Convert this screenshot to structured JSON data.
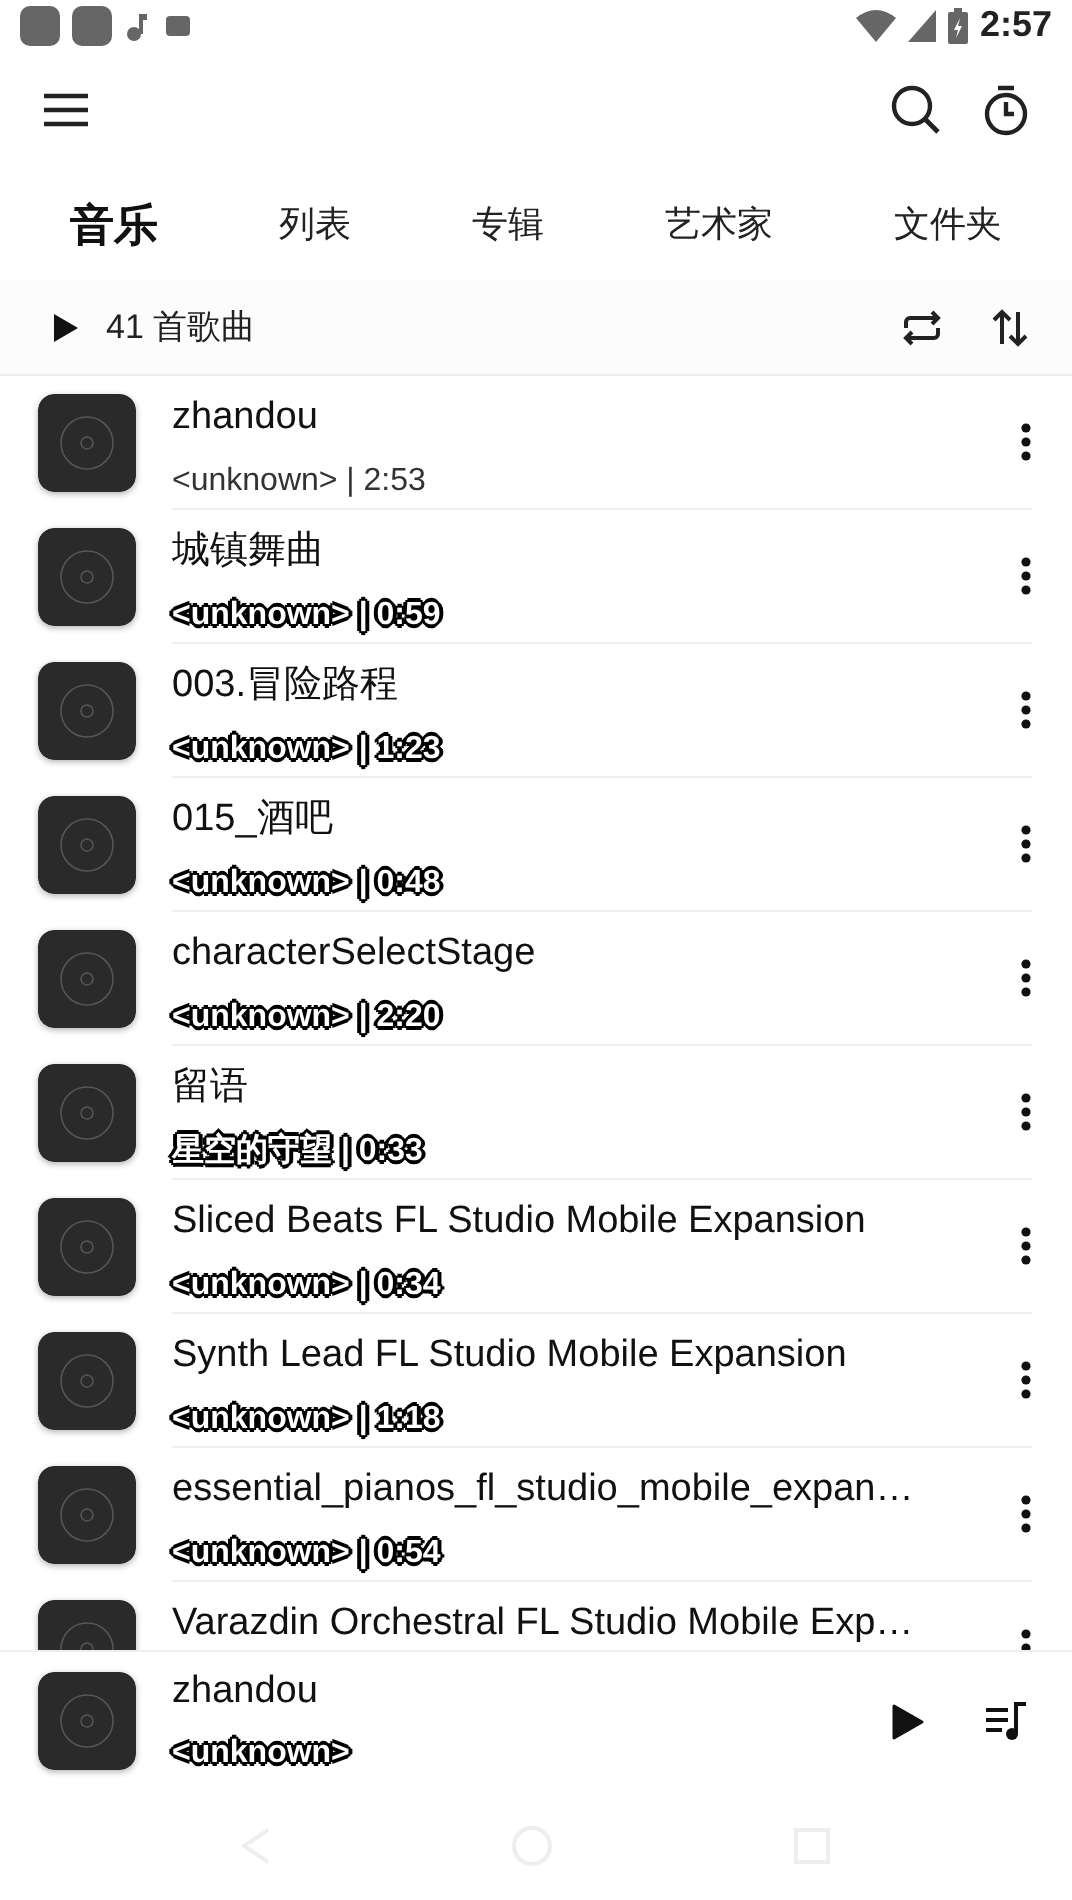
{
  "status_bar": {
    "time": "2:57"
  },
  "tabs": [
    {
      "label": "音乐",
      "selected": true
    },
    {
      "label": "列表",
      "selected": false
    },
    {
      "label": "专辑",
      "selected": false
    },
    {
      "label": "艺术家",
      "selected": false
    },
    {
      "label": "文件夹",
      "selected": false
    }
  ],
  "list_header": {
    "count": "41 首歌曲"
  },
  "songs": [
    {
      "title": "zhandou",
      "subtitle": "<unknown> | 2:53",
      "outlined": false
    },
    {
      "title": "城镇舞曲",
      "subtitle": "<unknown> | 0:59",
      "outlined": true
    },
    {
      "title": "003.冒险路程",
      "subtitle": "<unknown> | 1:23",
      "outlined": true
    },
    {
      "title": "015_酒吧",
      "subtitle": "<unknown> | 0:48",
      "outlined": true
    },
    {
      "title": "characterSelectStage",
      "subtitle": "<unknown> | 2:20",
      "outlined": true
    },
    {
      "title": "留语",
      "subtitle": "星空的守望 | 0:33",
      "outlined": true
    },
    {
      "title": "Sliced Beats FL Studio Mobile Expansion",
      "subtitle": "<unknown> | 0:34",
      "outlined": true
    },
    {
      "title": "Synth Lead FL Studio Mobile Expansion",
      "subtitle": "<unknown> | 1:18",
      "outlined": true
    },
    {
      "title": "essential_pianos_fl_studio_mobile_expan…",
      "subtitle": "<unknown> | 0:54",
      "outlined": true
    },
    {
      "title": "Varazdin Orchestral FL Studio Mobile Exp…"
    }
  ],
  "now_playing": {
    "title": "zhandou",
    "subtitle": "<unknown>",
    "outlined": true
  }
}
